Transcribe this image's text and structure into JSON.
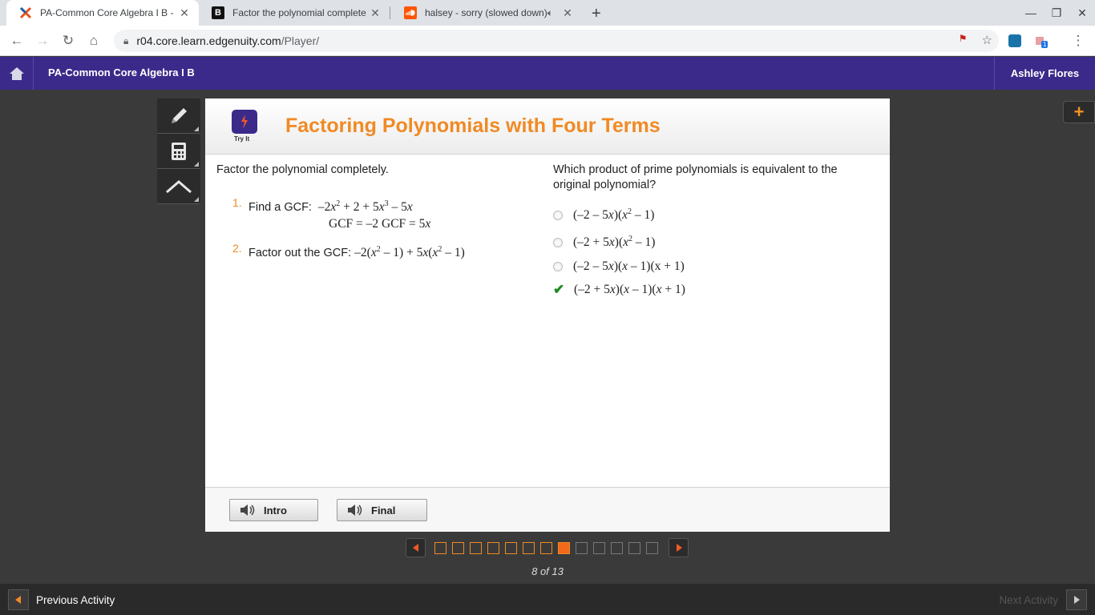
{
  "browser": {
    "tabs": [
      {
        "title": "PA-Common Core Algebra I B - E",
        "active": true,
        "icon": "edgenuity-x-icon"
      },
      {
        "title": "Factor the polynomial complete",
        "active": false,
        "icon": "brainly-b-icon"
      },
      {
        "title": "halsey - sorry (slowed down)",
        "active": false,
        "icon": "soundcloud-icon"
      }
    ],
    "url_host": "r04.core.learn.edgenuity.com",
    "url_path": "/Player/",
    "extension_badge": "1"
  },
  "header": {
    "course": "PA-Common Core Algebra I B",
    "user": "Ashley Flores"
  },
  "lesson": {
    "badge": "Try It",
    "title": "Factoring Polynomials with Four Terms"
  },
  "left": {
    "prompt": "Factor the polynomial completely.",
    "step1_num": "1.",
    "step1_label": "Find a GCF:",
    "step2_num": "2.",
    "step2_label": "Factor out the GCF:"
  },
  "right": {
    "question": "Which product of prime polynomials is equivalent to the original polynomial?",
    "options": [
      {
        "text": "(–2 – 5x)(x2 – 1)",
        "selected": false
      },
      {
        "text": "(–2 + 5x)(x2 – 1)",
        "selected": false
      },
      {
        "text": "(–2 – 5x)(x – 1)(x + 1)",
        "selected": false
      },
      {
        "text": "(–2 + 5x)(x – 1)(x + 1)",
        "selected": true
      }
    ]
  },
  "footer": {
    "intro_label": "Intro",
    "final_label": "Final"
  },
  "pager": {
    "current": 8,
    "total": 13,
    "label": "8 of 13"
  },
  "bottom": {
    "previous": "Previous Activity",
    "next": "Next Activity"
  },
  "colors": {
    "purple": "#3b2a8a",
    "orange": "#f08a24",
    "check": "#1e8a1e"
  }
}
